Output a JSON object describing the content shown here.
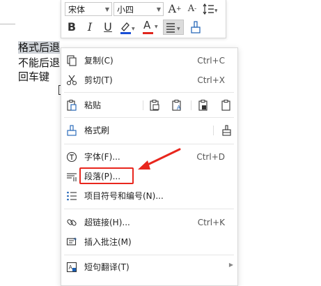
{
  "document": {
    "lines": [
      "格式后退",
      "不能后退",
      "回车键"
    ]
  },
  "toolbar": {
    "font_name": "宋体",
    "font_size": "小四",
    "grow_font_label": "A",
    "shrink_font_label": "A",
    "bold_label": "B",
    "italic_label": "I",
    "underline_label": "U",
    "font_color_label": "A",
    "highlight_color": "#1a4fd6",
    "font_color": "#e0261d"
  },
  "menu": {
    "copy": {
      "label": "复制(C)",
      "shortcut": "Ctrl+C"
    },
    "cut": {
      "label": "剪切(T)",
      "shortcut": "Ctrl+X"
    },
    "paste": {
      "label": "粘贴"
    },
    "format_painter": {
      "label": "格式刷"
    },
    "font": {
      "label": "字体(F)...",
      "shortcut": "Ctrl+D"
    },
    "paragraph": {
      "label": "段落(P)..."
    },
    "bullets": {
      "label": "项目符号和编号(N)..."
    },
    "hyperlink": {
      "label": "超链接(H)...",
      "shortcut": "Ctrl+K"
    },
    "comment": {
      "label": "插入批注(M)"
    },
    "translate": {
      "label": "短句翻译(T)"
    }
  },
  "annotation_color": "#e8261d"
}
